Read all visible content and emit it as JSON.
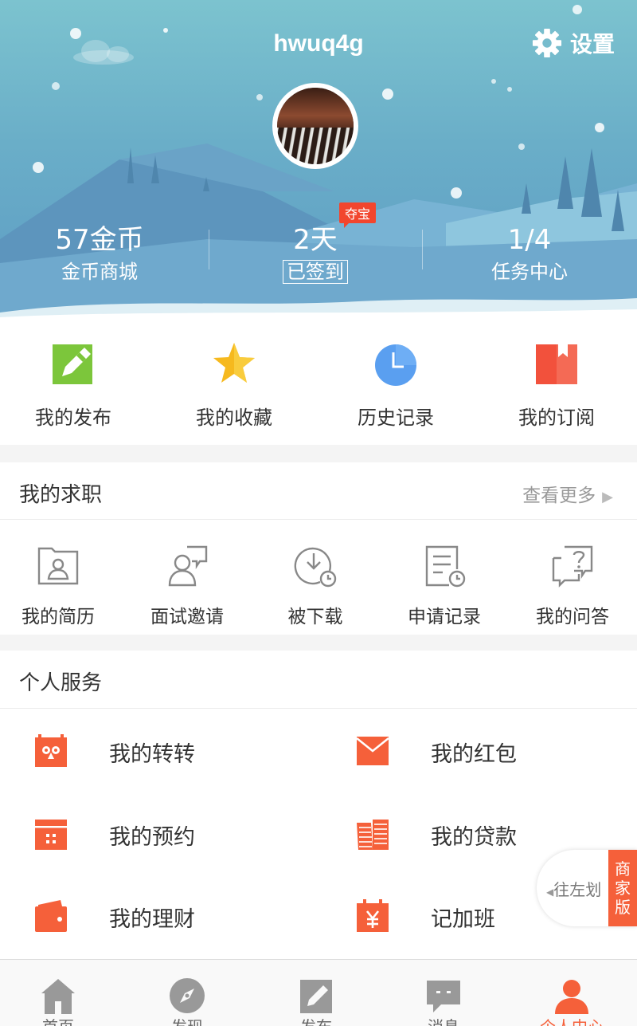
{
  "header": {
    "username": "hwuq4g",
    "settings_label": "设置",
    "stats": [
      {
        "value": "57金币",
        "label": "金币商城"
      },
      {
        "value": "2天",
        "label": "已签到",
        "badge": "夺宝"
      },
      {
        "value": "1/4",
        "label": "任务中心"
      }
    ]
  },
  "quick": [
    {
      "label": "我的发布",
      "icon": "edit-square-icon",
      "color": "#7cc63b"
    },
    {
      "label": "我的收藏",
      "icon": "star-icon",
      "color": "#f6b91e"
    },
    {
      "label": "历史记录",
      "icon": "clock-icon",
      "color": "#5a9ff0"
    },
    {
      "label": "我的订阅",
      "icon": "bookmark-book-icon",
      "color": "#f2513c"
    }
  ],
  "jobs": {
    "title": "我的求职",
    "more": "查看更多",
    "items": [
      {
        "label": "我的简历",
        "icon": "resume-icon"
      },
      {
        "label": "面试邀请",
        "icon": "interview-icon"
      },
      {
        "label": "被下载",
        "icon": "download-clock-icon"
      },
      {
        "label": "申请记录",
        "icon": "record-document-icon"
      },
      {
        "label": "我的问答",
        "icon": "question-chat-icon"
      }
    ]
  },
  "services": {
    "title": "个人服务",
    "items": [
      {
        "label": "我的转转",
        "icon": "zhuanzhuan-icon"
      },
      {
        "label": "我的红包",
        "icon": "red-envelope-icon"
      },
      {
        "label": "我的预约",
        "icon": "calendar-icon"
      },
      {
        "label": "我的贷款",
        "icon": "money-stack-icon"
      },
      {
        "label": "我的理财",
        "icon": "wallet-icon"
      },
      {
        "label": "记加班",
        "icon": "yen-calendar-icon"
      }
    ]
  },
  "float_tab": {
    "text": "往左划",
    "tag": "商家版"
  },
  "tabbar": [
    {
      "label": "首页",
      "icon": "home-icon"
    },
    {
      "label": "发现",
      "icon": "compass-icon"
    },
    {
      "label": "发布",
      "icon": "post-edit-icon"
    },
    {
      "label": "消息",
      "icon": "message-icon"
    },
    {
      "label": "个人中心",
      "icon": "person-icon"
    }
  ],
  "colors": {
    "accent": "#f5603a",
    "header_top": "#7cc3cf",
    "header_bottom": "#5d9cc4"
  }
}
